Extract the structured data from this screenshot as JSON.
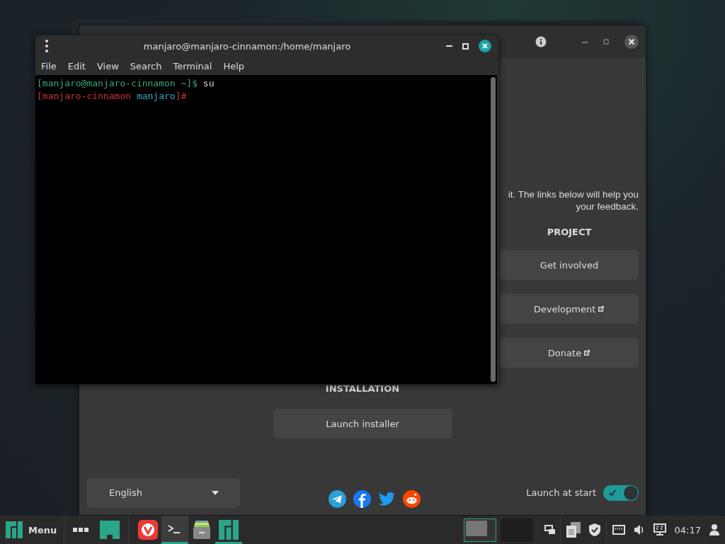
{
  "welcome": {
    "intro_lines": [
      "it. The links below will help you",
      "your feedback."
    ],
    "project": {
      "heading": "PROJECT",
      "links": [
        {
          "label": "Get involved",
          "external": false
        },
        {
          "label": "Development",
          "external": true
        },
        {
          "label": "Donate",
          "external": true
        }
      ]
    },
    "installation": {
      "heading": "INSTALLATION",
      "button": "Launch installer"
    },
    "language": "English",
    "launch_at_start": {
      "label": "Launch at start",
      "on": true
    }
  },
  "terminal": {
    "title": "manjaro@manjaro-cinnamon:/home/manjaro",
    "menu": [
      "File",
      "Edit",
      "View",
      "Search",
      "Terminal",
      "Help"
    ],
    "lines": [
      [
        {
          "text": "[manjaro@manjaro-cinnamon ~]$",
          "color": "#3ea37a"
        },
        {
          "text": " su",
          "color": "#d0d0d0"
        }
      ],
      [
        {
          "text": "[manjaro-cinnamon",
          "color": "#c8313c"
        },
        {
          "text": " manjaro",
          "color": "#3aa6c9"
        },
        {
          "text": "]#",
          "color": "#c8313c"
        }
      ]
    ]
  },
  "taskbar": {
    "menu_label": "Menu",
    "apps": [
      {
        "kind": "browser",
        "selected": false,
        "running": false
      },
      {
        "kind": "terminal",
        "selected": true,
        "running": true
      },
      {
        "kind": "files",
        "selected": false,
        "running": false
      },
      {
        "kind": "hello",
        "selected": false,
        "running": true
      }
    ],
    "workspaces": [
      {
        "selected": true
      },
      {
        "selected": false
      }
    ],
    "clock": "04:17"
  }
}
